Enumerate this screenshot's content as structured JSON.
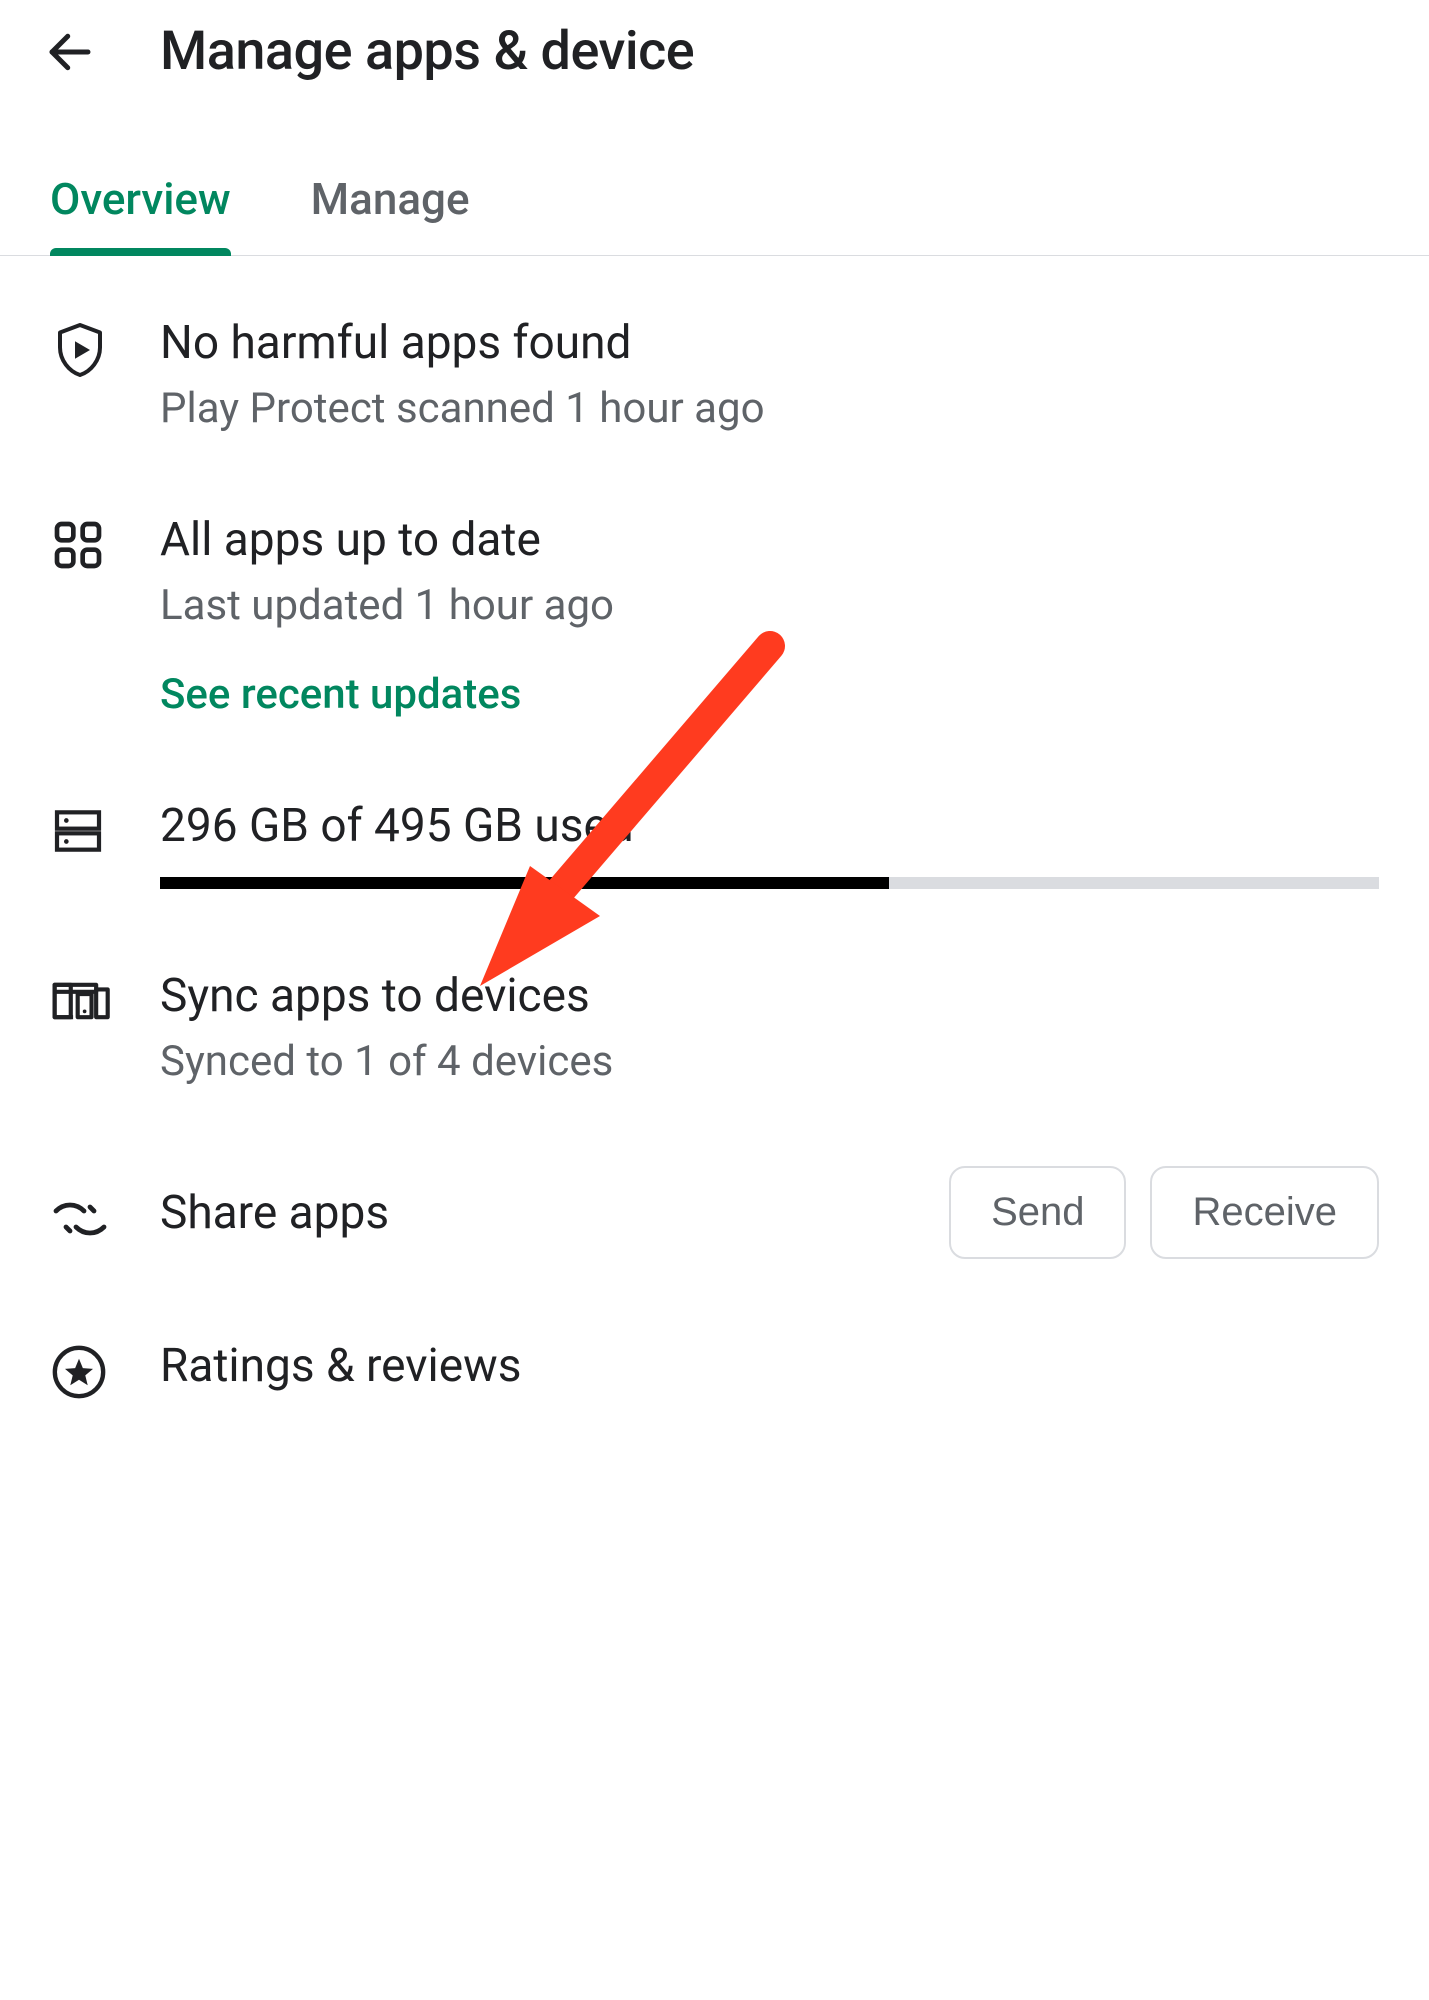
{
  "header": {
    "title": "Manage apps & device"
  },
  "tabs": {
    "overview": "Overview",
    "manage": "Manage",
    "active": "overview"
  },
  "protect": {
    "title": "No harmful apps found",
    "subtitle": "Play Protect scanned 1 hour ago"
  },
  "updates": {
    "title": "All apps up to date",
    "subtitle": "Last updated 1 hour ago",
    "link": "See recent updates"
  },
  "storage": {
    "label": "296 GB of 495 GB used",
    "used": 296,
    "total": 495
  },
  "sync": {
    "title": "Sync apps to devices",
    "subtitle": "Synced to 1 of 4 devices"
  },
  "share": {
    "title": "Share apps",
    "send": "Send",
    "receive": "Receive"
  },
  "ratings": {
    "title": "Ratings & reviews"
  },
  "annotation": {
    "arrow_points_to": "sync-apps-row",
    "color": "#ff3b1f"
  }
}
